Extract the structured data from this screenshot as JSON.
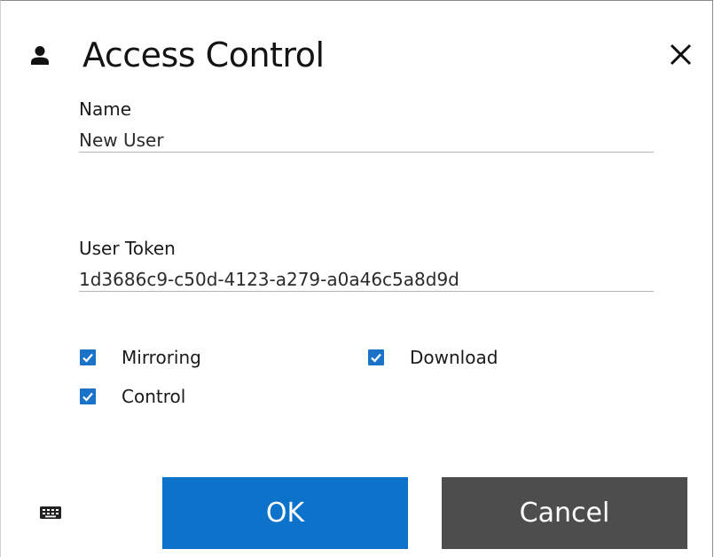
{
  "dialog": {
    "title": "Access Control",
    "title_icon": "user-icon",
    "close_icon": "close-icon"
  },
  "fields": {
    "name_label": "Name",
    "name_value": "New User",
    "token_label": "User Token",
    "token_value": "1d3686c9-c50d-4123-a279-a0a46c5a8d9d"
  },
  "permissions": [
    {
      "label": "Mirroring",
      "checked": true
    },
    {
      "label": "Download",
      "checked": true
    },
    {
      "label": "Control",
      "checked": true
    }
  ],
  "footer": {
    "keyboard_icon": "keyboard-icon",
    "ok_label": "OK",
    "cancel_label": "Cancel"
  },
  "colors": {
    "accent": "#0d72c9",
    "checkbox": "#1a73c7",
    "cancel_bg": "#4d4d4d"
  }
}
